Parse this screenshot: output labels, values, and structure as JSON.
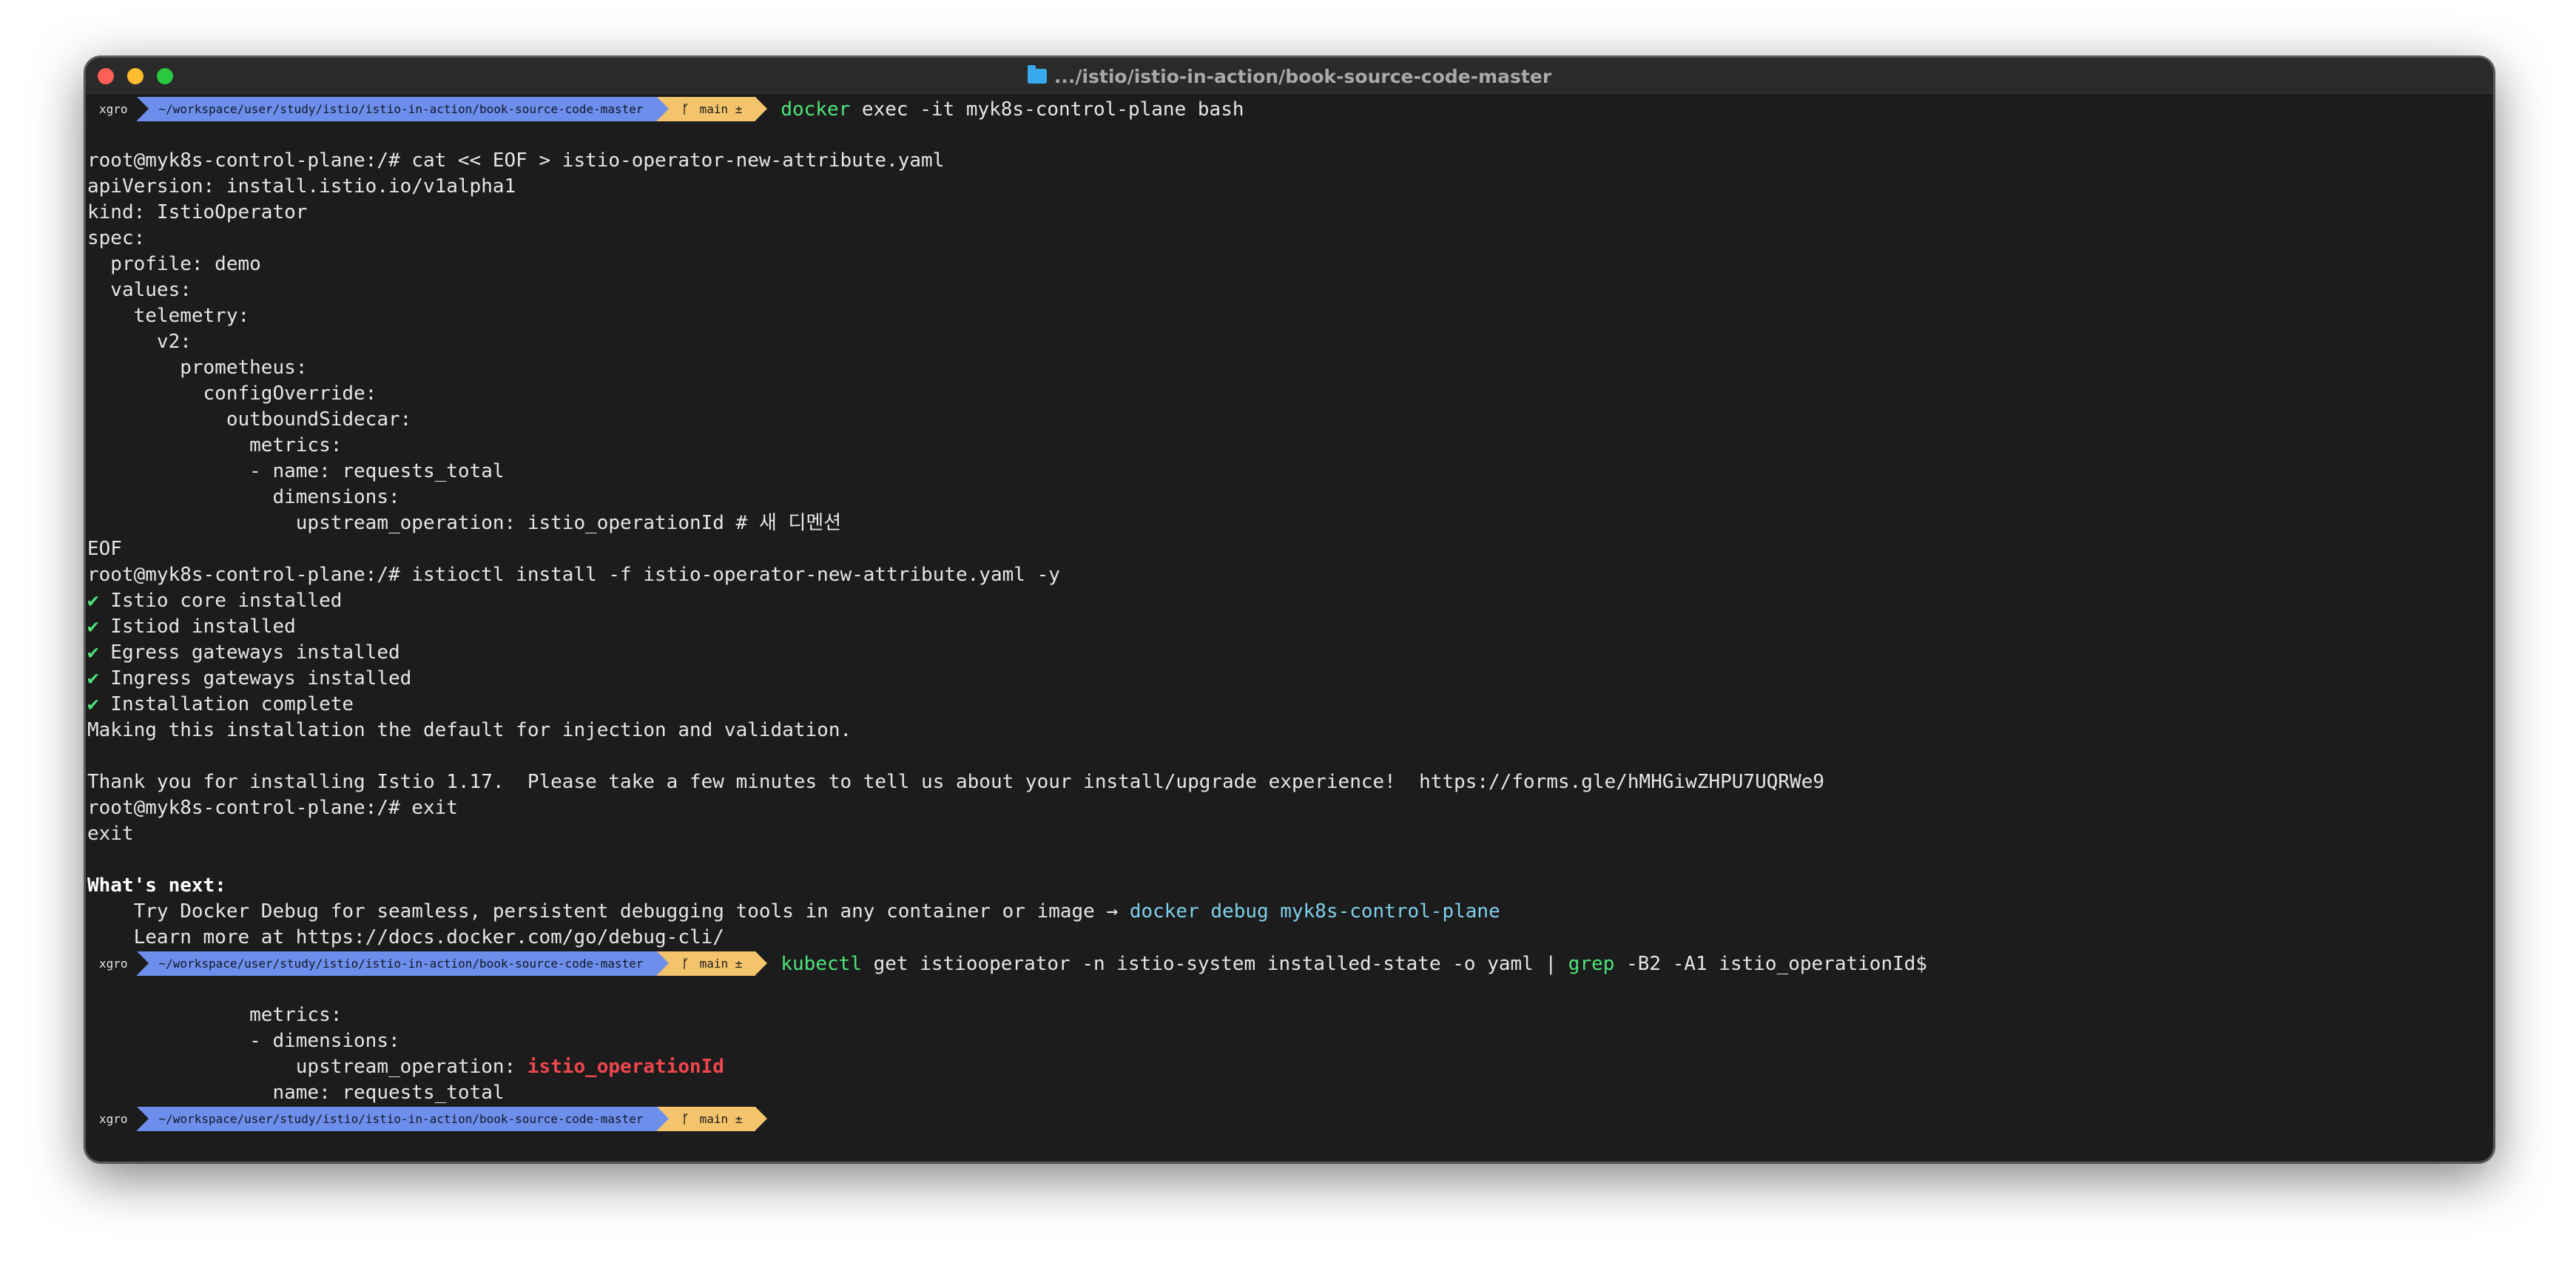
{
  "window": {
    "title": ".../istio/istio-in-action/book-source-code-master",
    "title_icon": "folder-icon"
  },
  "prompt": {
    "user": "xgro",
    "path": "~/workspace/user/study/istio/istio-in-action/book-source-code-master",
    "branch_icon": "git-branch-icon",
    "branch": "main ±"
  },
  "colors": {
    "background": "#1c1c1c",
    "path_segment": "#6d8eea",
    "git_segment": "#f3c46b",
    "command_green": "#4ee47a",
    "highlight_cyan": "#7fd0ea",
    "match_red": "#f0464d"
  },
  "commands": {
    "docker_cmd": "docker",
    "docker_args": " exec -it myk8s-control-plane bash",
    "kubectl_cmd": "kubectl",
    "kubectl_args_1": " get istiooperator -n istio-system installed-state -o yaml | ",
    "grep_cmd": "grep",
    "kubectl_args_2": " -B2 -A1 istio_operationId$"
  },
  "output": {
    "l01": "root@myk8s-control-plane:/# cat << EOF > istio-operator-new-attribute.yaml",
    "l02": "apiVersion: install.istio.io/v1alpha1",
    "l03": "kind: IstioOperator",
    "l04": "spec:",
    "l05": "  profile: demo",
    "l06": "  values:",
    "l07": "    telemetry:",
    "l08": "      v2:",
    "l09": "        prometheus:",
    "l10": "          configOverride:",
    "l11": "            outboundSidecar:",
    "l12": "              metrics:",
    "l13": "              - name: requests_total",
    "l14": "                dimensions:",
    "l15": "                  upstream_operation: istio_operationId # 새 디멘션",
    "l16": "EOF",
    "l17": "root@myk8s-control-plane:/# istioctl install -f istio-operator-new-attribute.yaml -y",
    "check_mark": "✔",
    "l18": " Istio core installed",
    "l19": " Istiod installed",
    "l20": " Egress gateways installed",
    "l21": " Ingress gateways installed",
    "l22": " Installation complete",
    "l23": "Making this installation the default for injection and validation.",
    "l24": "Thank you for installing Istio 1.17.  Please take a few minutes to tell us about your install/upgrade experience!  https://forms.gle/hMHGiwZHPU7UQRWe9",
    "l25": "root@myk8s-control-plane:/# exit",
    "l26": "exit",
    "l27": "What's next:",
    "l28a": "    Try Docker Debug for seamless, persistent debugging tools in any container or image → ",
    "l28b": "docker debug myk8s-control-plane",
    "l29": "    Learn more at https://docs.docker.com/go/debug-cli/",
    "l30": "              metrics:",
    "l31": "              - dimensions:",
    "l32a": "                  upstream_operation: ",
    "l32b": "istio_operationId",
    "l33": "                name: requests_total"
  }
}
